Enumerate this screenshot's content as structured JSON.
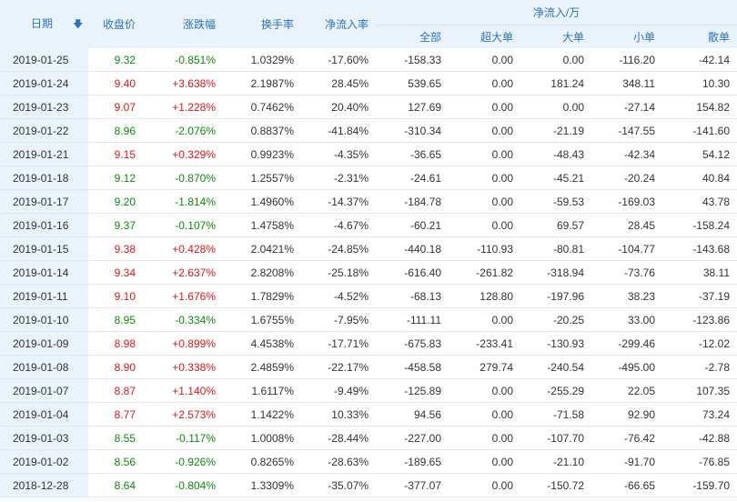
{
  "header": {
    "date": "日期",
    "close": "收盘价",
    "change": "涨跌幅",
    "turnover": "换手率",
    "net_rate": "净流入率",
    "net_group": "净流入/万",
    "all": "全部",
    "super_large": "超大单",
    "large": "大单",
    "small": "小单",
    "retail": "散单",
    "sort_icon": "arrow-down-icon"
  },
  "colors": {
    "up": "#e01616",
    "down": "#0f8a0f",
    "header_bg": "#eaf3fc",
    "header_text": "#2d74b8"
  },
  "rows": [
    {
      "date": "2019-01-25",
      "close": "9.32",
      "change": "-0.851%",
      "turnover": "1.0329%",
      "net_rate": "-17.60%",
      "all": "-158.33",
      "super_large": "0.00",
      "large": "0.00",
      "small": "-116.20",
      "retail": "-42.14",
      "dir": "down"
    },
    {
      "date": "2019-01-24",
      "close": "9.40",
      "change": "+3.638%",
      "turnover": "2.1987%",
      "net_rate": "28.45%",
      "all": "539.65",
      "super_large": "0.00",
      "large": "181.24",
      "small": "348.11",
      "retail": "10.30",
      "dir": "up"
    },
    {
      "date": "2019-01-23",
      "close": "9.07",
      "change": "+1.228%",
      "turnover": "0.7462%",
      "net_rate": "20.40%",
      "all": "127.69",
      "super_large": "0.00",
      "large": "0.00",
      "small": "-27.14",
      "retail": "154.82",
      "dir": "up"
    },
    {
      "date": "2019-01-22",
      "close": "8.96",
      "change": "-2.076%",
      "turnover": "0.8837%",
      "net_rate": "-41.84%",
      "all": "-310.34",
      "super_large": "0.00",
      "large": "-21.19",
      "small": "-147.55",
      "retail": "-141.60",
      "dir": "down"
    },
    {
      "date": "2019-01-21",
      "close": "9.15",
      "change": "+0.329%",
      "turnover": "0.9923%",
      "net_rate": "-4.35%",
      "all": "-36.65",
      "super_large": "0.00",
      "large": "-48.43",
      "small": "-42.34",
      "retail": "54.12",
      "dir": "up"
    },
    {
      "date": "2019-01-18",
      "close": "9.12",
      "change": "-0.870%",
      "turnover": "1.2557%",
      "net_rate": "-2.31%",
      "all": "-24.61",
      "super_large": "0.00",
      "large": "-45.21",
      "small": "-20.24",
      "retail": "40.84",
      "dir": "down"
    },
    {
      "date": "2019-01-17",
      "close": "9.20",
      "change": "-1.814%",
      "turnover": "1.4960%",
      "net_rate": "-14.37%",
      "all": "-184.78",
      "super_large": "0.00",
      "large": "-59.53",
      "small": "-169.03",
      "retail": "43.78",
      "dir": "down"
    },
    {
      "date": "2019-01-16",
      "close": "9.37",
      "change": "-0.107%",
      "turnover": "1.4758%",
      "net_rate": "-4.67%",
      "all": "-60.21",
      "super_large": "0.00",
      "large": "69.57",
      "small": "28.45",
      "retail": "-158.24",
      "dir": "down"
    },
    {
      "date": "2019-01-15",
      "close": "9.38",
      "change": "+0.428%",
      "turnover": "2.0421%",
      "net_rate": "-24.85%",
      "all": "-440.18",
      "super_large": "-110.93",
      "large": "-80.81",
      "small": "-104.77",
      "retail": "-143.68",
      "dir": "up"
    },
    {
      "date": "2019-01-14",
      "close": "9.34",
      "change": "+2.637%",
      "turnover": "2.8208%",
      "net_rate": "-25.18%",
      "all": "-616.40",
      "super_large": "-261.82",
      "large": "-318.94",
      "small": "-73.76",
      "retail": "38.11",
      "dir": "up"
    },
    {
      "date": "2019-01-11",
      "close": "9.10",
      "change": "+1.676%",
      "turnover": "1.7829%",
      "net_rate": "-4.52%",
      "all": "-68.13",
      "super_large": "128.80",
      "large": "-197.96",
      "small": "38.23",
      "retail": "-37.19",
      "dir": "up"
    },
    {
      "date": "2019-01-10",
      "close": "8.95",
      "change": "-0.334%",
      "turnover": "1.6755%",
      "net_rate": "-7.95%",
      "all": "-111.11",
      "super_large": "0.00",
      "large": "-20.25",
      "small": "33.00",
      "retail": "-123.86",
      "dir": "down"
    },
    {
      "date": "2019-01-09",
      "close": "8.98",
      "change": "+0.899%",
      "turnover": "4.4538%",
      "net_rate": "-17.71%",
      "all": "-675.83",
      "super_large": "-233.41",
      "large": "-130.93",
      "small": "-299.46",
      "retail": "-12.02",
      "dir": "up"
    },
    {
      "date": "2019-01-08",
      "close": "8.90",
      "change": "+0.338%",
      "turnover": "2.4859%",
      "net_rate": "-22.17%",
      "all": "-458.58",
      "super_large": "279.74",
      "large": "-240.54",
      "small": "-495.00",
      "retail": "-2.78",
      "dir": "up"
    },
    {
      "date": "2019-01-07",
      "close": "8.87",
      "change": "+1.140%",
      "turnover": "1.6117%",
      "net_rate": "-9.49%",
      "all": "-125.89",
      "super_large": "0.00",
      "large": "-255.29",
      "small": "22.05",
      "retail": "107.35",
      "dir": "up"
    },
    {
      "date": "2019-01-04",
      "close": "8.77",
      "change": "+2.573%",
      "turnover": "1.1422%",
      "net_rate": "10.33%",
      "all": "94.56",
      "super_large": "0.00",
      "large": "-71.58",
      "small": "92.90",
      "retail": "73.24",
      "dir": "up"
    },
    {
      "date": "2019-01-03",
      "close": "8.55",
      "change": "-0.117%",
      "turnover": "1.0008%",
      "net_rate": "-28.44%",
      "all": "-227.00",
      "super_large": "0.00",
      "large": "-107.70",
      "small": "-76.42",
      "retail": "-42.88",
      "dir": "down"
    },
    {
      "date": "2019-01-02",
      "close": "8.56",
      "change": "-0.926%",
      "turnover": "0.8265%",
      "net_rate": "-28.63%",
      "all": "-189.65",
      "super_large": "0.00",
      "large": "-21.10",
      "small": "-91.70",
      "retail": "-76.85",
      "dir": "down"
    },
    {
      "date": "2018-12-28",
      "close": "8.64",
      "change": "-0.804%",
      "turnover": "1.3309%",
      "net_rate": "-35.07%",
      "all": "-377.07",
      "super_large": "0.00",
      "large": "-150.72",
      "small": "-66.65",
      "retail": "-159.70",
      "dir": "down"
    }
  ]
}
